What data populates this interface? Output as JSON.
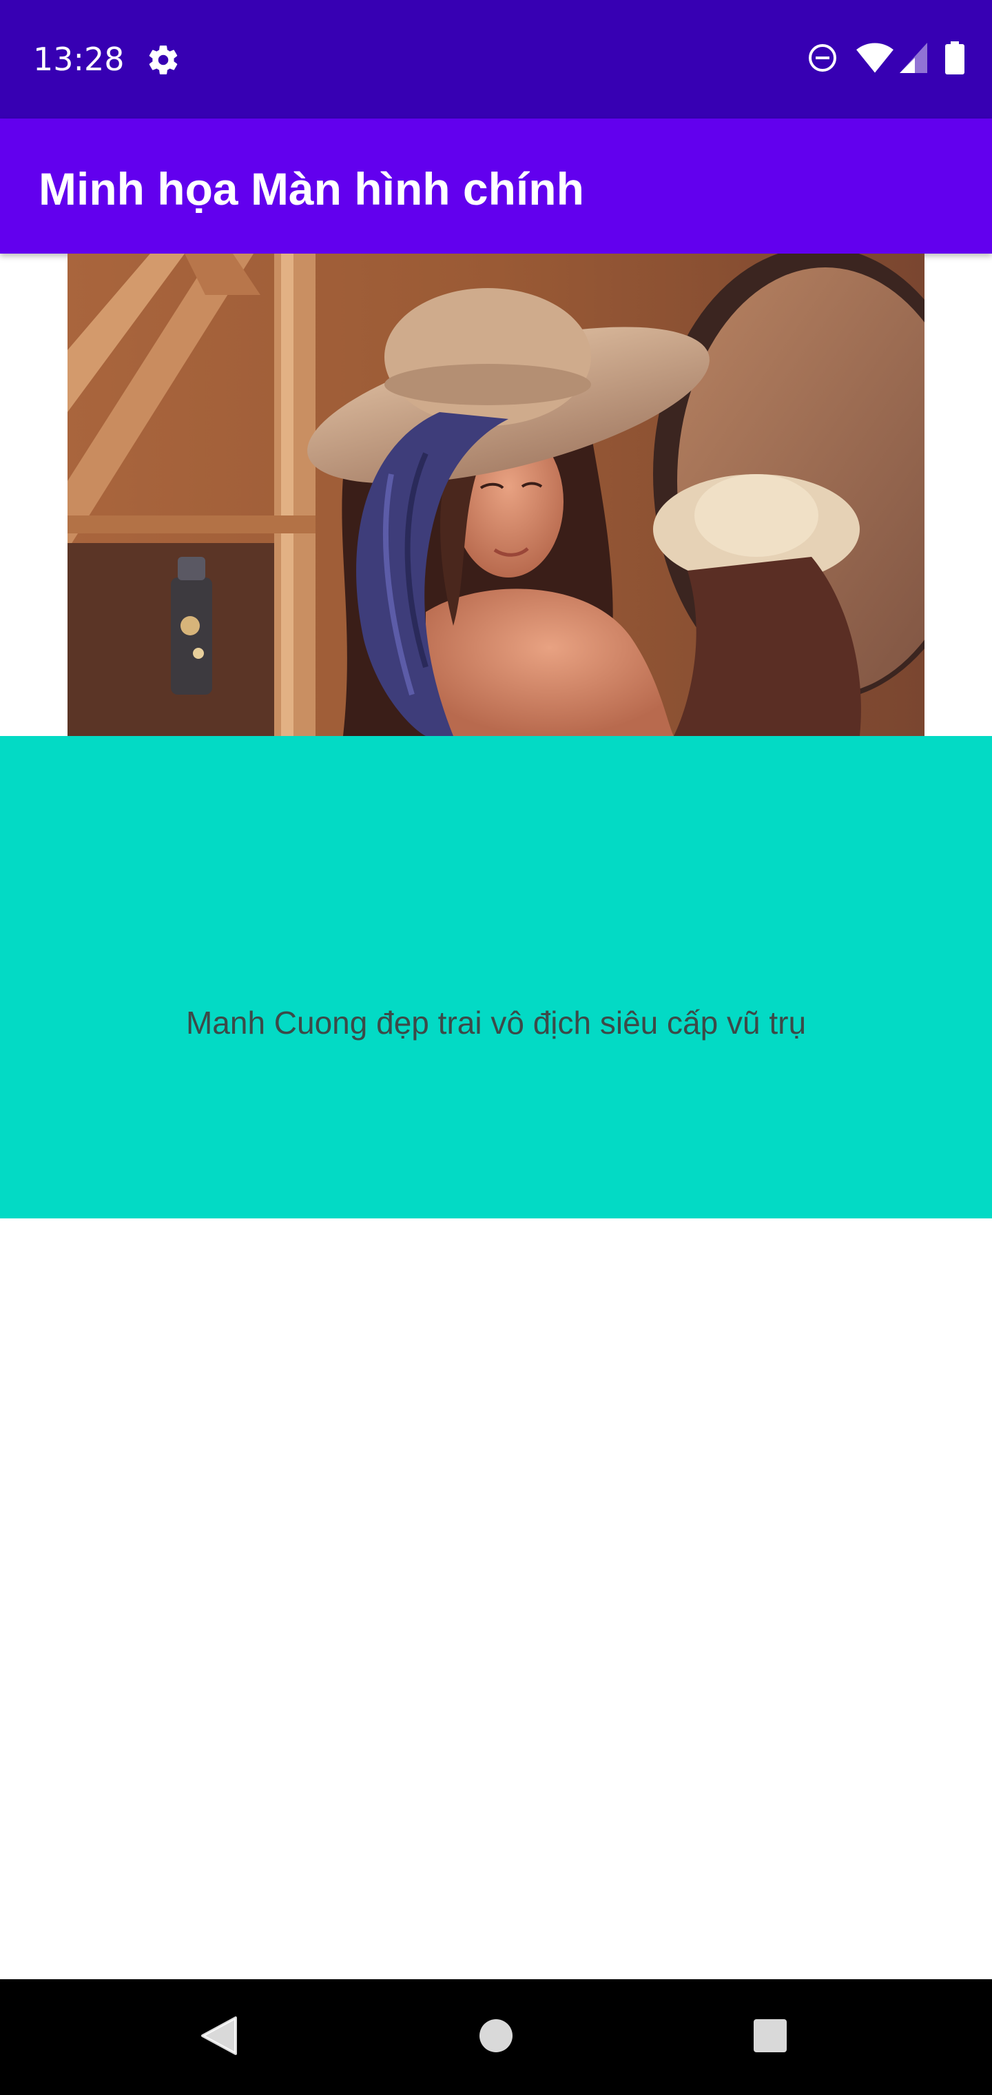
{
  "status_bar": {
    "time": "13:28",
    "icons": [
      "gear-icon",
      "do-not-disturb-icon",
      "wifi-icon",
      "cell-signal-icon",
      "battery-icon"
    ],
    "background": "#3700b3"
  },
  "app_bar": {
    "title": "Minh họa Màn hình chính",
    "background": "#6200ee"
  },
  "main": {
    "image": "woman-in-hat-mirror-photo",
    "panel_text": "Manh Cuong đẹp trai vô địch siêu cấp vũ trụ",
    "panel_background": "#03dac5"
  },
  "nav_bar": {
    "buttons": [
      "back-icon",
      "home-icon",
      "recents-icon"
    ]
  }
}
